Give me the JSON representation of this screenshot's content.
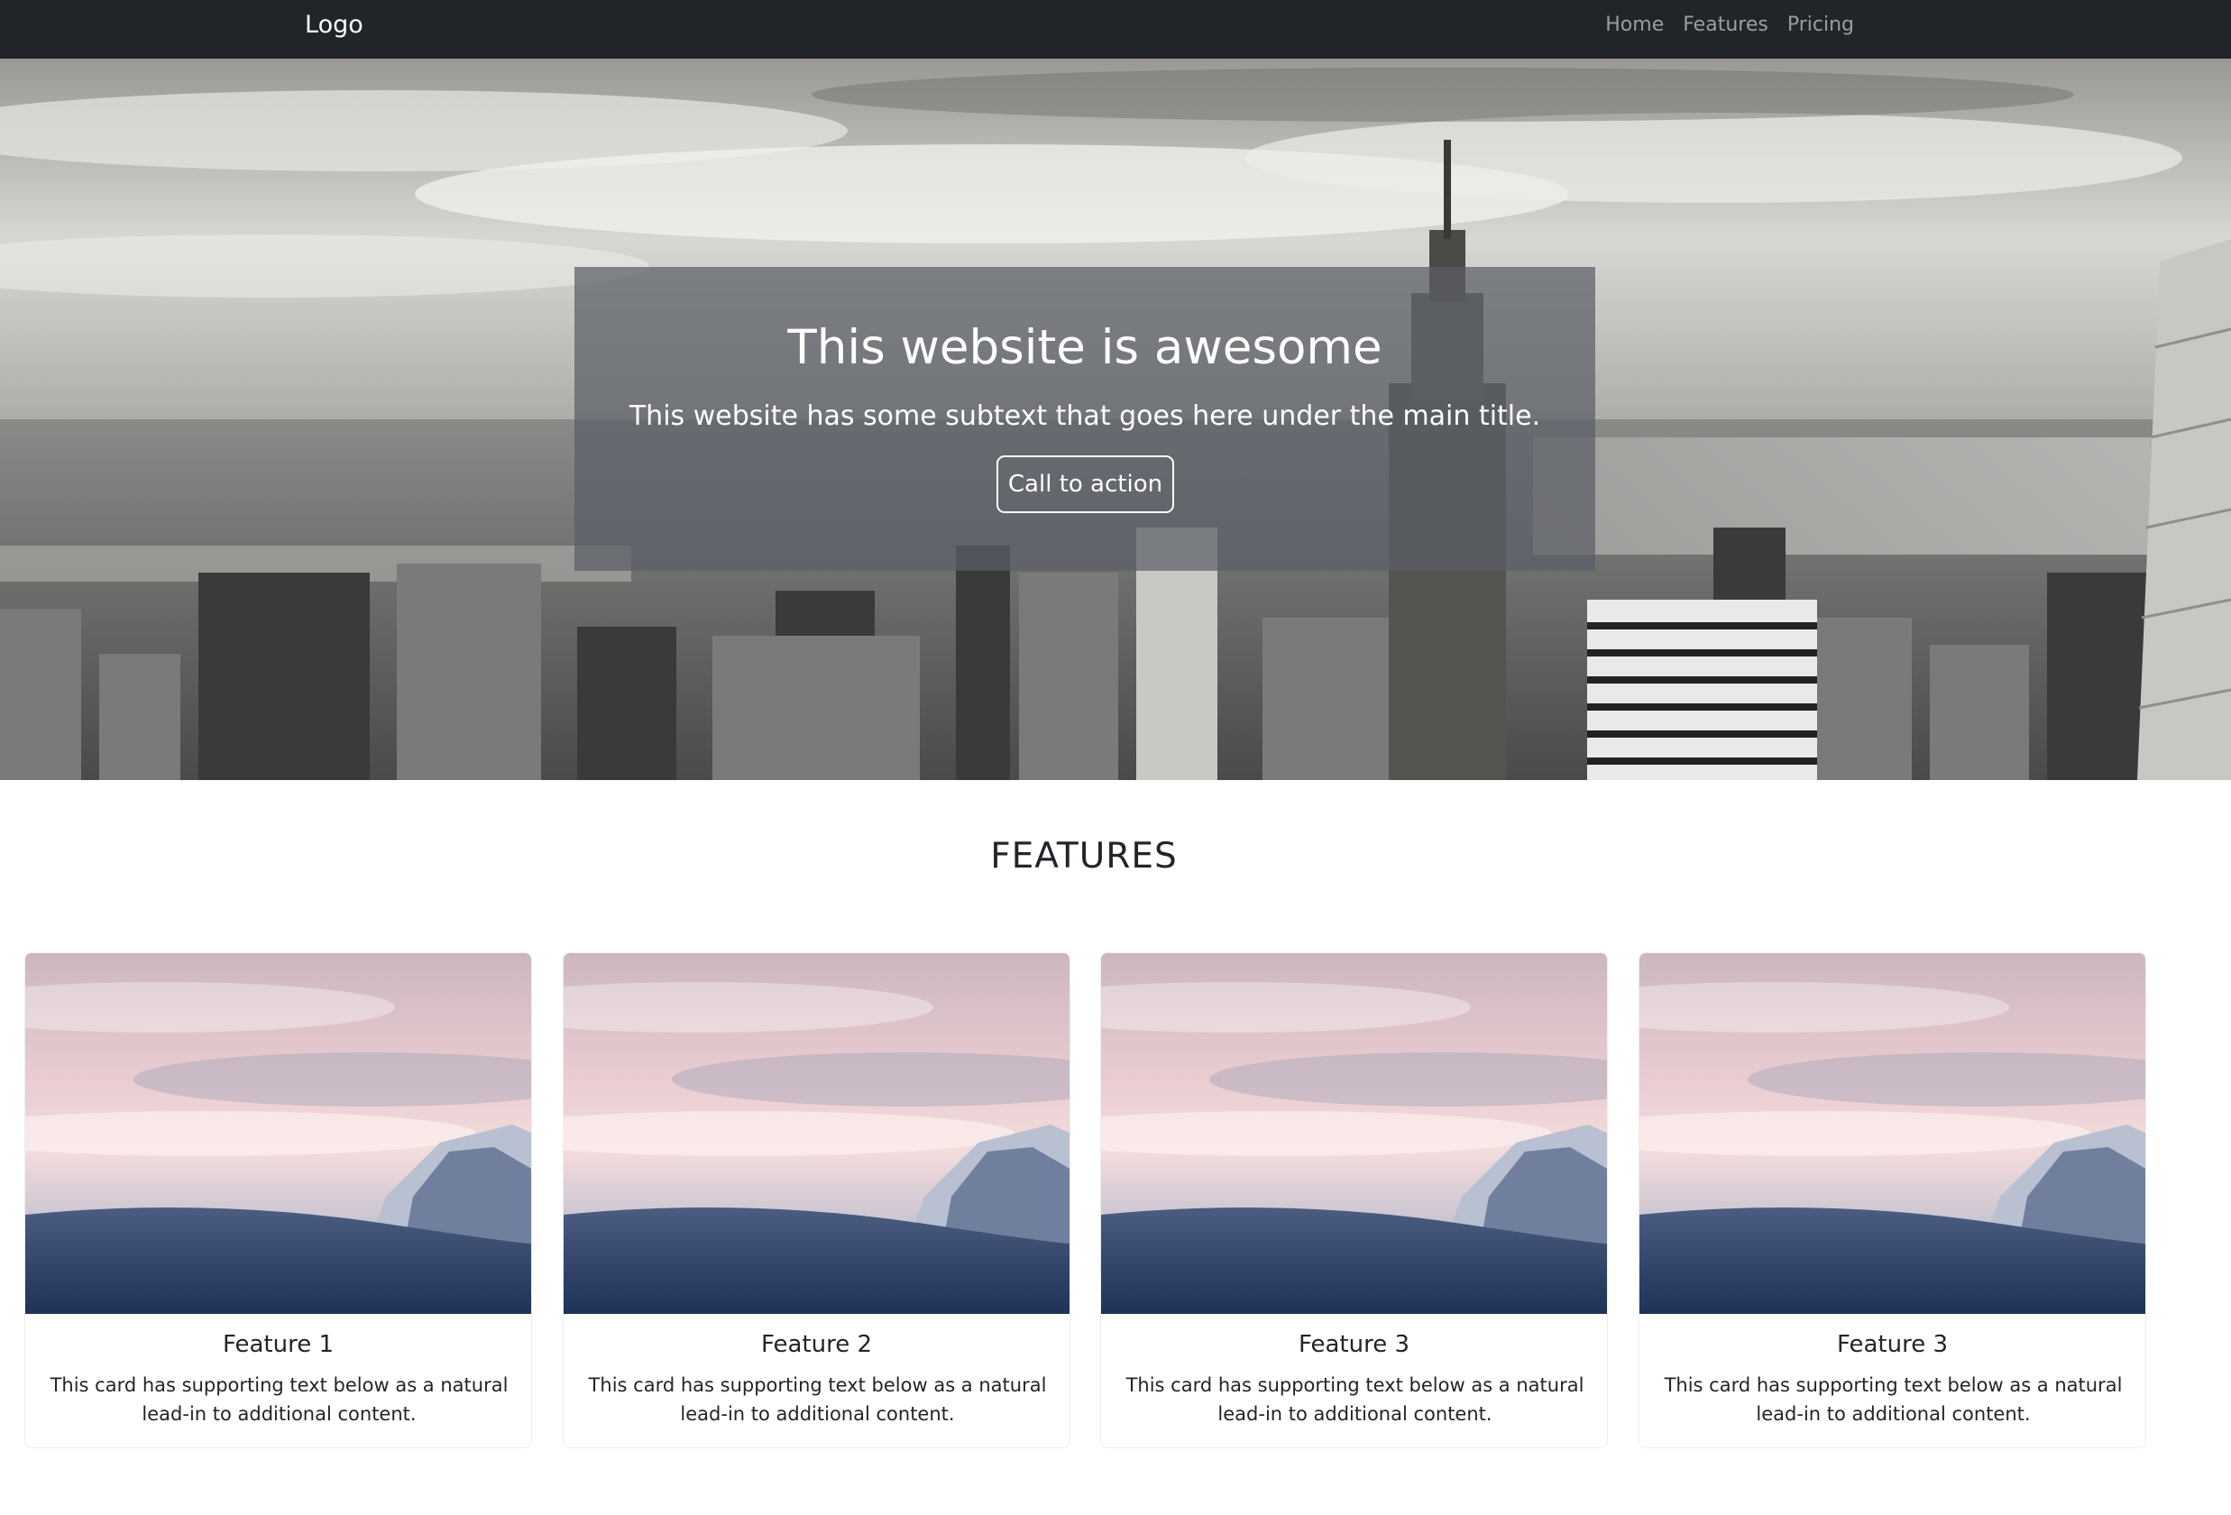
{
  "navbar": {
    "logo": "Logo",
    "links": [
      "Home",
      "Features",
      "Pricing"
    ]
  },
  "hero": {
    "title": "This website is awesome",
    "subtitle": "This website has some subtext that goes here under the main title.",
    "cta_label": "Call to action"
  },
  "features": {
    "heading": "FEATURES",
    "cards": [
      {
        "title": "Feature 1",
        "text": "This card has supporting text below as a natural lead-in to additional content."
      },
      {
        "title": "Feature 2",
        "text": "This card has supporting text below as a natural lead-in to additional content."
      },
      {
        "title": "Feature 3",
        "text": "This card has supporting text below as a natural lead-in to additional content."
      },
      {
        "title": "Feature 3",
        "text": "This card has supporting text below as a natural lead-in to additional content."
      }
    ]
  },
  "colors": {
    "navbar_bg": "#212529",
    "nav_link": "#8c8f93",
    "hero_overlay": "#5a5e66",
    "text_dark": "#212529"
  }
}
